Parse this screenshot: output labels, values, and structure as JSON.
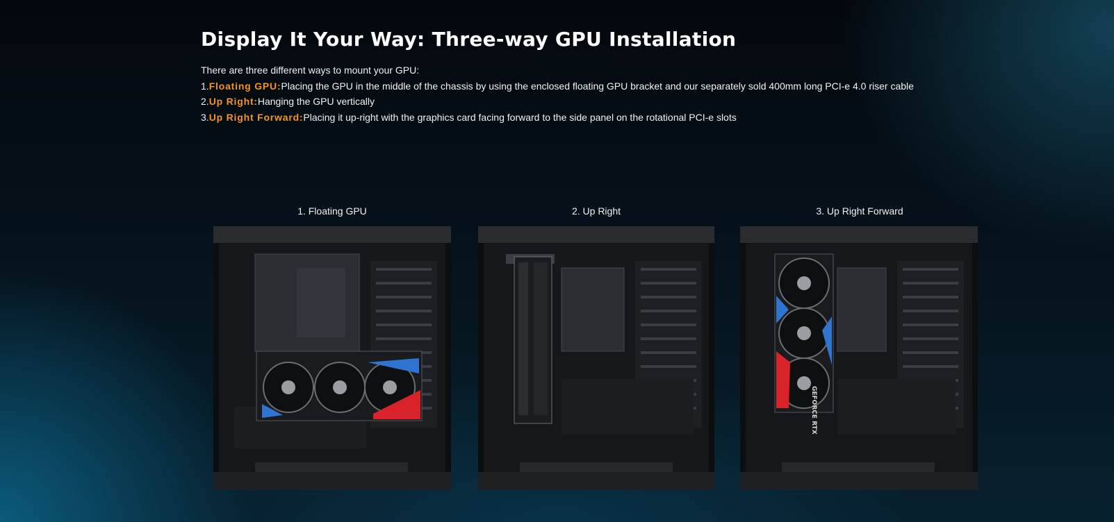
{
  "heading": "Display It Your Way: Three-way GPU Installation",
  "intro": "There are three different ways to mount your GPU:",
  "methods": [
    {
      "num": "1.",
      "name": "Floating GPU:",
      "text": "Placing the GPU in the middle of the chassis by using the enclosed floating GPU bracket and our separately sold 400mm long PCI-e 4.0 riser cable"
    },
    {
      "num": "2.",
      "name": "Up Right:",
      "text": "Hanging the GPU vertically"
    },
    {
      "num": "3.",
      "name": "Up Right Forward:",
      "text": "Placing it up-right with the graphics card facing forward to the side panel on the rotational PCI-e slots"
    }
  ],
  "gallery": [
    {
      "caption": "1. Floating GPU"
    },
    {
      "caption": "2. Up Right"
    },
    {
      "caption": "3. Up Right Forward",
      "gpu_label": "GEFORCE RTX"
    }
  ],
  "colors": {
    "accent": "#f5941f",
    "rog_red": "#d8232a",
    "rog_blue": "#2f74d0"
  }
}
